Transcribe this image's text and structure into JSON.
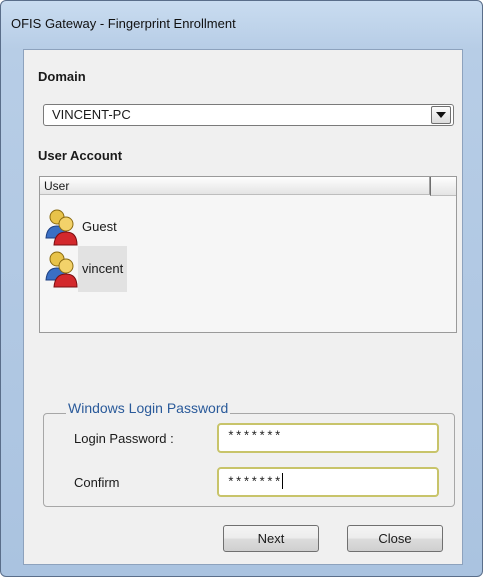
{
  "window": {
    "title": "OFIS Gateway - Fingerprint Enrollment"
  },
  "domain": {
    "label": "Domain",
    "selected": "VINCENT-PC"
  },
  "accounts": {
    "label": "User Account",
    "column_header": "User",
    "items": [
      {
        "name": "Guest",
        "icon": "user-group-icon"
      },
      {
        "name": "vincent",
        "icon": "user-group-icon"
      }
    ]
  },
  "password": {
    "group_title": "Windows Login Password",
    "login_label": "Login Password :",
    "login_value": "*******",
    "confirm_label": "Confirm",
    "confirm_value": "*******"
  },
  "buttons": {
    "next": "Next",
    "close": "Close"
  },
  "colors": {
    "group_title": "#2a5a9a",
    "input_border": "#c8c46a"
  }
}
